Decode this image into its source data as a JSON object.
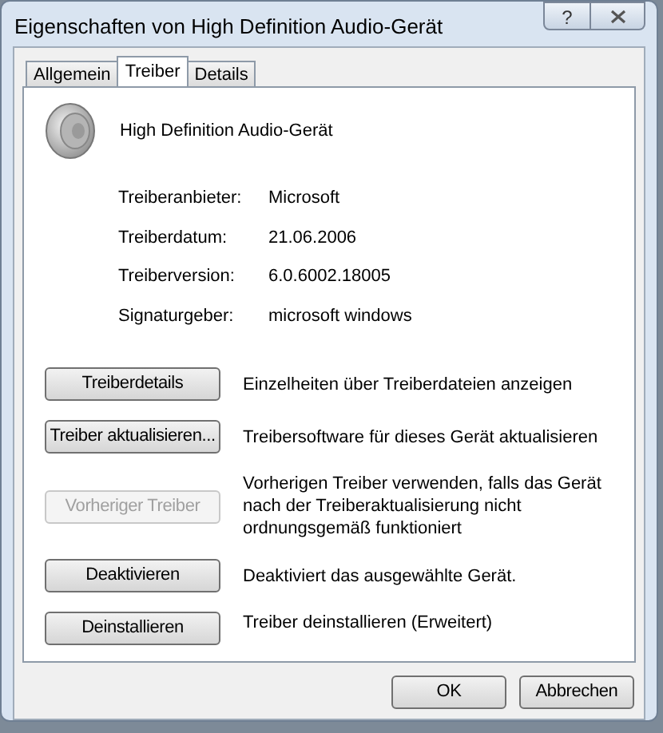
{
  "window": {
    "title": "Eigenschaften von High Definition Audio-Gerät",
    "help_button": "?"
  },
  "tabs": [
    {
      "label": "Allgemein",
      "selected": false
    },
    {
      "label": "Treiber",
      "selected": true
    },
    {
      "label": "Details",
      "selected": false
    }
  ],
  "device": {
    "name": "High Definition Audio-Gerät"
  },
  "properties": [
    {
      "label": "Treiberanbieter:",
      "value": "Microsoft"
    },
    {
      "label": "Treiberdatum:",
      "value": "21.06.2006"
    },
    {
      "label": "Treiberversion:",
      "value": "6.0.6002.18005"
    },
    {
      "label": "Signaturgeber:",
      "value": "microsoft windows"
    }
  ],
  "actions": [
    {
      "button": "Treiberdetails",
      "disabled": false,
      "description": "Einzelheiten über Treiberdateien anzeigen"
    },
    {
      "button": "Treiber aktualisieren...",
      "disabled": false,
      "description": "Treibersoftware für dieses Gerät aktualisieren"
    },
    {
      "button": "Vorheriger Treiber",
      "disabled": true,
      "description": "Vorherigen Treiber verwenden, falls das Gerät nach der Treiberaktualisierung nicht ordnungsgemäß funktioniert"
    },
    {
      "button": "Deaktivieren",
      "disabled": false,
      "description": "Deaktiviert das ausgewählte Gerät."
    },
    {
      "button": "Deinstallieren",
      "disabled": false,
      "description": "Treiber deinstallieren (Erweitert)"
    }
  ],
  "buttons": [
    "OK",
    "Abbrechen"
  ]
}
